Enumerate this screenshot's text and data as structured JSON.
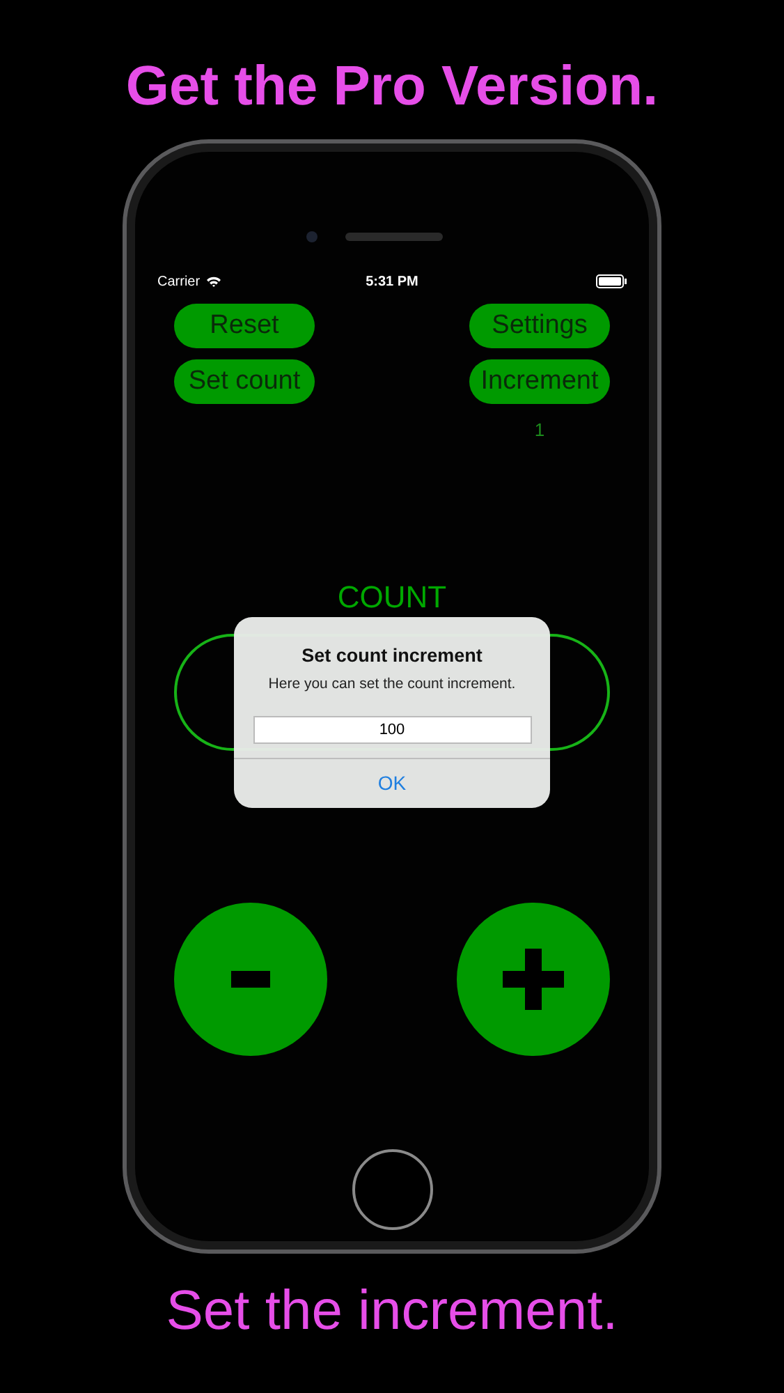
{
  "headline": "Get the Pro Version.",
  "status_bar": {
    "carrier": "Carrier",
    "time": "5:31 PM"
  },
  "buttons_left": [
    "Reset",
    "Set count"
  ],
  "buttons_right": [
    "Settings",
    "Increment"
  ],
  "increment_value": "1",
  "count_label": "COUNT",
  "alert": {
    "title": "Set count increment",
    "message": "Here you can set the count increment.",
    "field_value": "100",
    "action": "OK"
  },
  "caption": "Set the increment."
}
